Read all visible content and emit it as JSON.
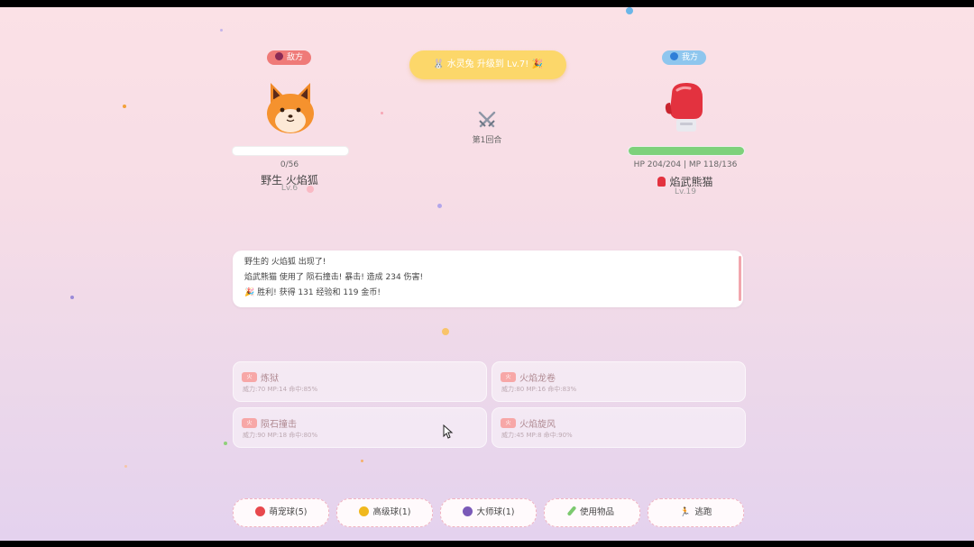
{
  "enemy": {
    "badge": "敌方",
    "hp_text": "0/56",
    "hp_fraction": 0,
    "name": "野生 火焰狐",
    "level": "Lv.6"
  },
  "player": {
    "badge": "我方",
    "hp_text": "HP 204/204 | MP 118/136",
    "hp_fraction": 1,
    "name": "焰武熊猫",
    "level": "Lv.19"
  },
  "banner": {
    "text": "水灵兔 升级到 Lv.7!"
  },
  "round": {
    "label": "第1回合"
  },
  "log": {
    "lines": [
      "野生的 火焰狐 出现了!",
      "焰武熊猫 使用了 陨石撞击! 暴击! 造成 234 伤害!",
      "胜利! 获得 131 经验和 119 金币!"
    ]
  },
  "moves": [
    {
      "type": "火",
      "name": "炼狱",
      "info": "威力:70 MP:14 命中:85%"
    },
    {
      "type": "火",
      "name": "火焰龙卷",
      "info": "威力:80 MP:16 命中:83%"
    },
    {
      "type": "火",
      "name": "陨石撞击",
      "info": "威力:90 MP:18 命中:80%"
    },
    {
      "type": "火",
      "name": "火焰旋风",
      "info": "威力:45 MP:8 命中:90%"
    }
  ],
  "actions": [
    {
      "label": "萌宠球(5)",
      "color": "#e8484d"
    },
    {
      "label": "高级球(1)",
      "color": "#f0b81e"
    },
    {
      "label": "大师球(1)",
      "color": "#7a5ab8"
    },
    {
      "label": "使用物品"
    },
    {
      "label": "逃跑"
    }
  ]
}
